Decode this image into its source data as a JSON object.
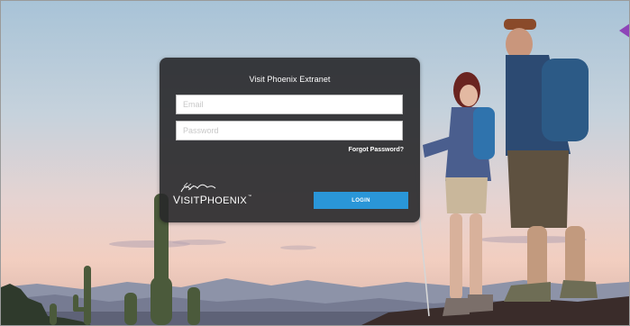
{
  "login": {
    "title": "Visit Phoenix Extranet",
    "email_placeholder": "Email",
    "password_placeholder": "Password",
    "forgot_label": "Forgot Password?",
    "login_label": "LOGIN"
  },
  "brand": {
    "logo_first": "V",
    "logo_mid": "ISIT",
    "logo_second": "P",
    "logo_rest": "HOENIX",
    "trademark": "™"
  },
  "icons": {
    "slide_arrow": "chevron-left-icon"
  },
  "colors": {
    "card_background": "#2a2a2c",
    "login_button": "#2a96d8",
    "slide_arrow": "#8e44b8",
    "sky_top": "#a9c2d6",
    "horizon_glow": "#f2cfc1"
  }
}
